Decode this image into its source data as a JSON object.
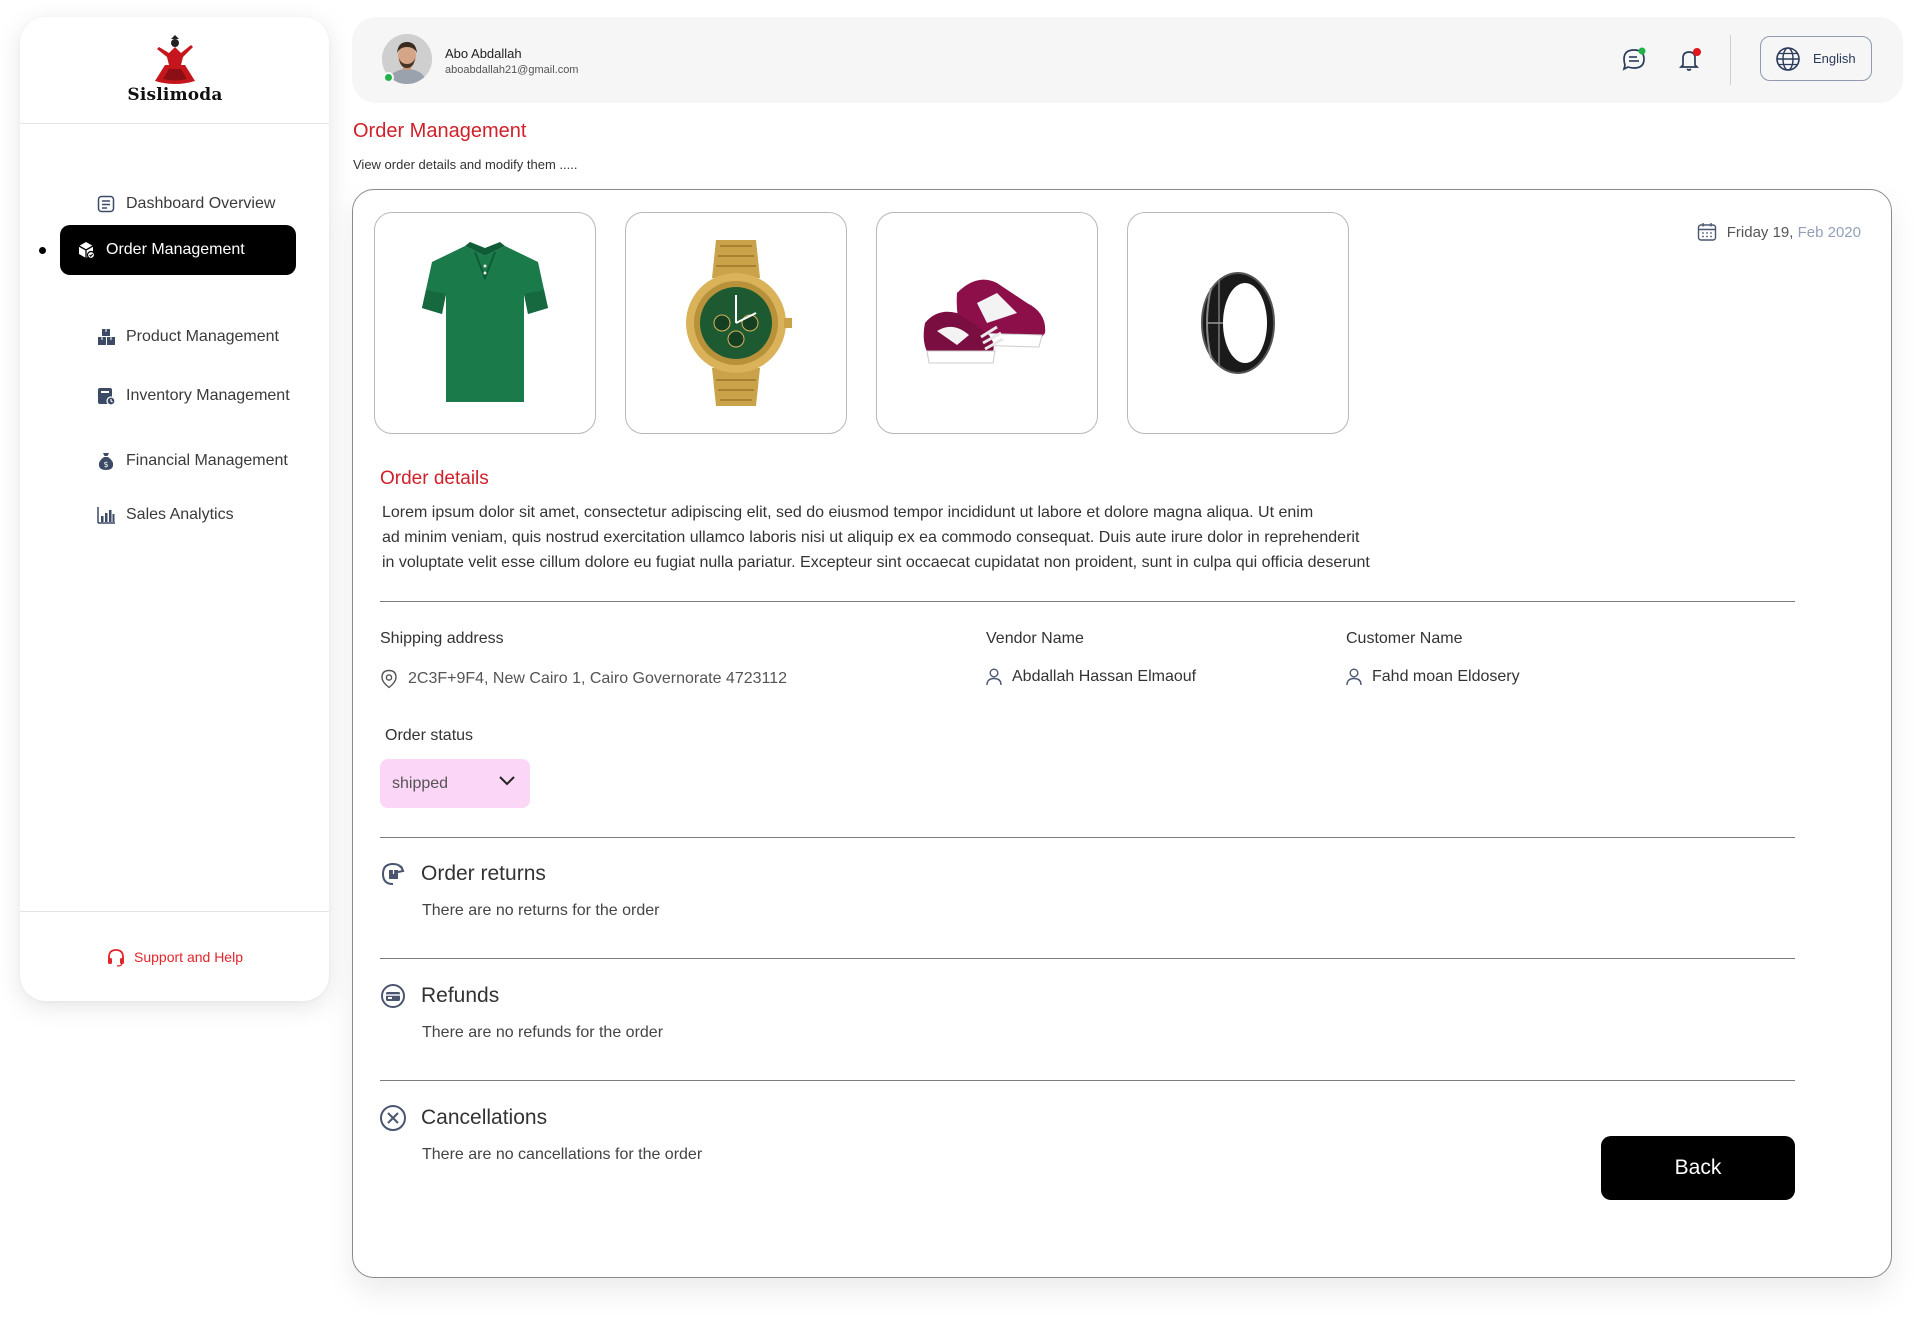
{
  "brand": {
    "name": "Sislimoda"
  },
  "sidebar": {
    "items": [
      {
        "label": "Dashboard Overview",
        "icon": "dashboard-icon"
      },
      {
        "label": "Order Management",
        "icon": "order-box-icon",
        "active": true
      },
      {
        "label": "Product Management",
        "icon": "product-boxes-icon"
      },
      {
        "label": "Inventory Management",
        "icon": "inventory-icon"
      },
      {
        "label": "Financial Management",
        "icon": "money-bag-icon"
      },
      {
        "label": "Sales Analytics",
        "icon": "bar-chart-icon"
      }
    ],
    "support_label": "Support and Help"
  },
  "header": {
    "user_name": "Abo Abdallah",
    "user_email": "aboabdallah21@gmail.com",
    "language": "English"
  },
  "page": {
    "title": "Order Management",
    "subtitle": "View order details and modify them ....."
  },
  "order": {
    "products": [
      {
        "name": "green-polo-shirt"
      },
      {
        "name": "gold-watch"
      },
      {
        "name": "sneakers"
      },
      {
        "name": "black-ring"
      }
    ],
    "date_day": "Friday 19,",
    "date_rest": "Feb 2020",
    "details_title": "Order details",
    "description_lines": [
      "Lorem ipsum dolor sit amet, consectetur adipiscing elit, sed do eiusmod tempor incididunt ut labore et dolore magna aliqua. Ut enim",
      "ad minim veniam, quis nostrud exercitation ullamco laboris nisi ut aliquip ex ea commodo consequat. Duis aute irure dolor in reprehenderit",
      "in voluptate velit esse cillum dolore eu fugiat nulla pariatur. Excepteur sint occaecat cupidatat non proident, sunt in culpa qui officia deserunt"
    ],
    "shipping_label": "Shipping address",
    "shipping_value": "2C3F+9F4, New Cairo 1, Cairo Governorate 4723112",
    "vendor_label": "Vendor Name",
    "vendor_value": "Abdallah Hassan Elmaouf",
    "customer_label": "Customer Name",
    "customer_value": "Fahd moan Eldosery",
    "status_label": "Order status",
    "status_value": "shipped",
    "returns_title": "Order returns",
    "returns_text": "There are no returns for the order",
    "refunds_title": "Refunds",
    "refunds_text": "There are no refunds for the order",
    "cancellations_title": "Cancellations",
    "cancellations_text": "There are no cancellations for the order",
    "back_label": "Back"
  },
  "colors": {
    "accent": "#d0202a",
    "status_bg": "#fcd6f6",
    "online": "#22b24c"
  }
}
